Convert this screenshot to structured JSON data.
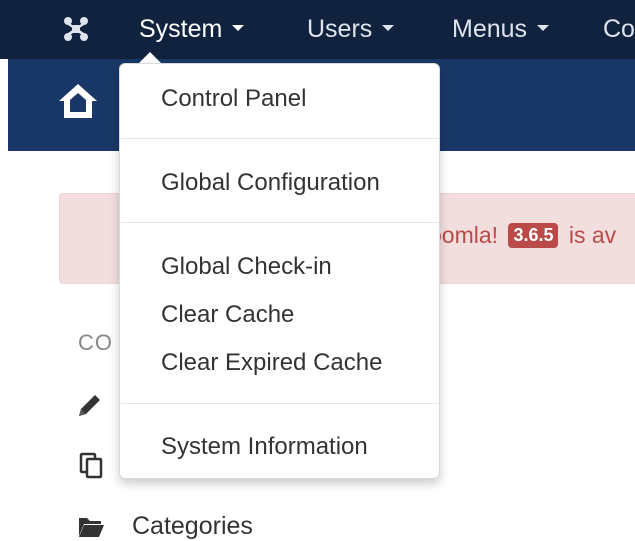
{
  "navbar": {
    "logo_icon": "joomla-logo-icon",
    "items": [
      {
        "label": "System",
        "active": true
      },
      {
        "label": "Users"
      },
      {
        "label": "Menus"
      },
      {
        "label": "Co"
      }
    ]
  },
  "header": {
    "home_icon": "home-icon"
  },
  "alert": {
    "text_before": "oomla!",
    "version": "3.6.5",
    "text_after": "is av"
  },
  "sidebar": {
    "heading": "CO",
    "items": [
      {
        "icon": "pencil-icon",
        "label": ""
      },
      {
        "icon": "copy-icon",
        "label": ""
      },
      {
        "icon": "folder-icon",
        "label": "Categories"
      }
    ]
  },
  "dropdown": {
    "groups": [
      [
        "Control Panel"
      ],
      [
        "Global Configuration"
      ],
      [
        "Global Check-in",
        "Clear Cache",
        "Clear Expired Cache"
      ],
      [
        "System Information"
      ]
    ]
  },
  "colors": {
    "navbar_bg": "#10223e",
    "header_bg": "#1a3867",
    "alert_bg": "#f2dede",
    "badge_bg": "#b94a48"
  }
}
